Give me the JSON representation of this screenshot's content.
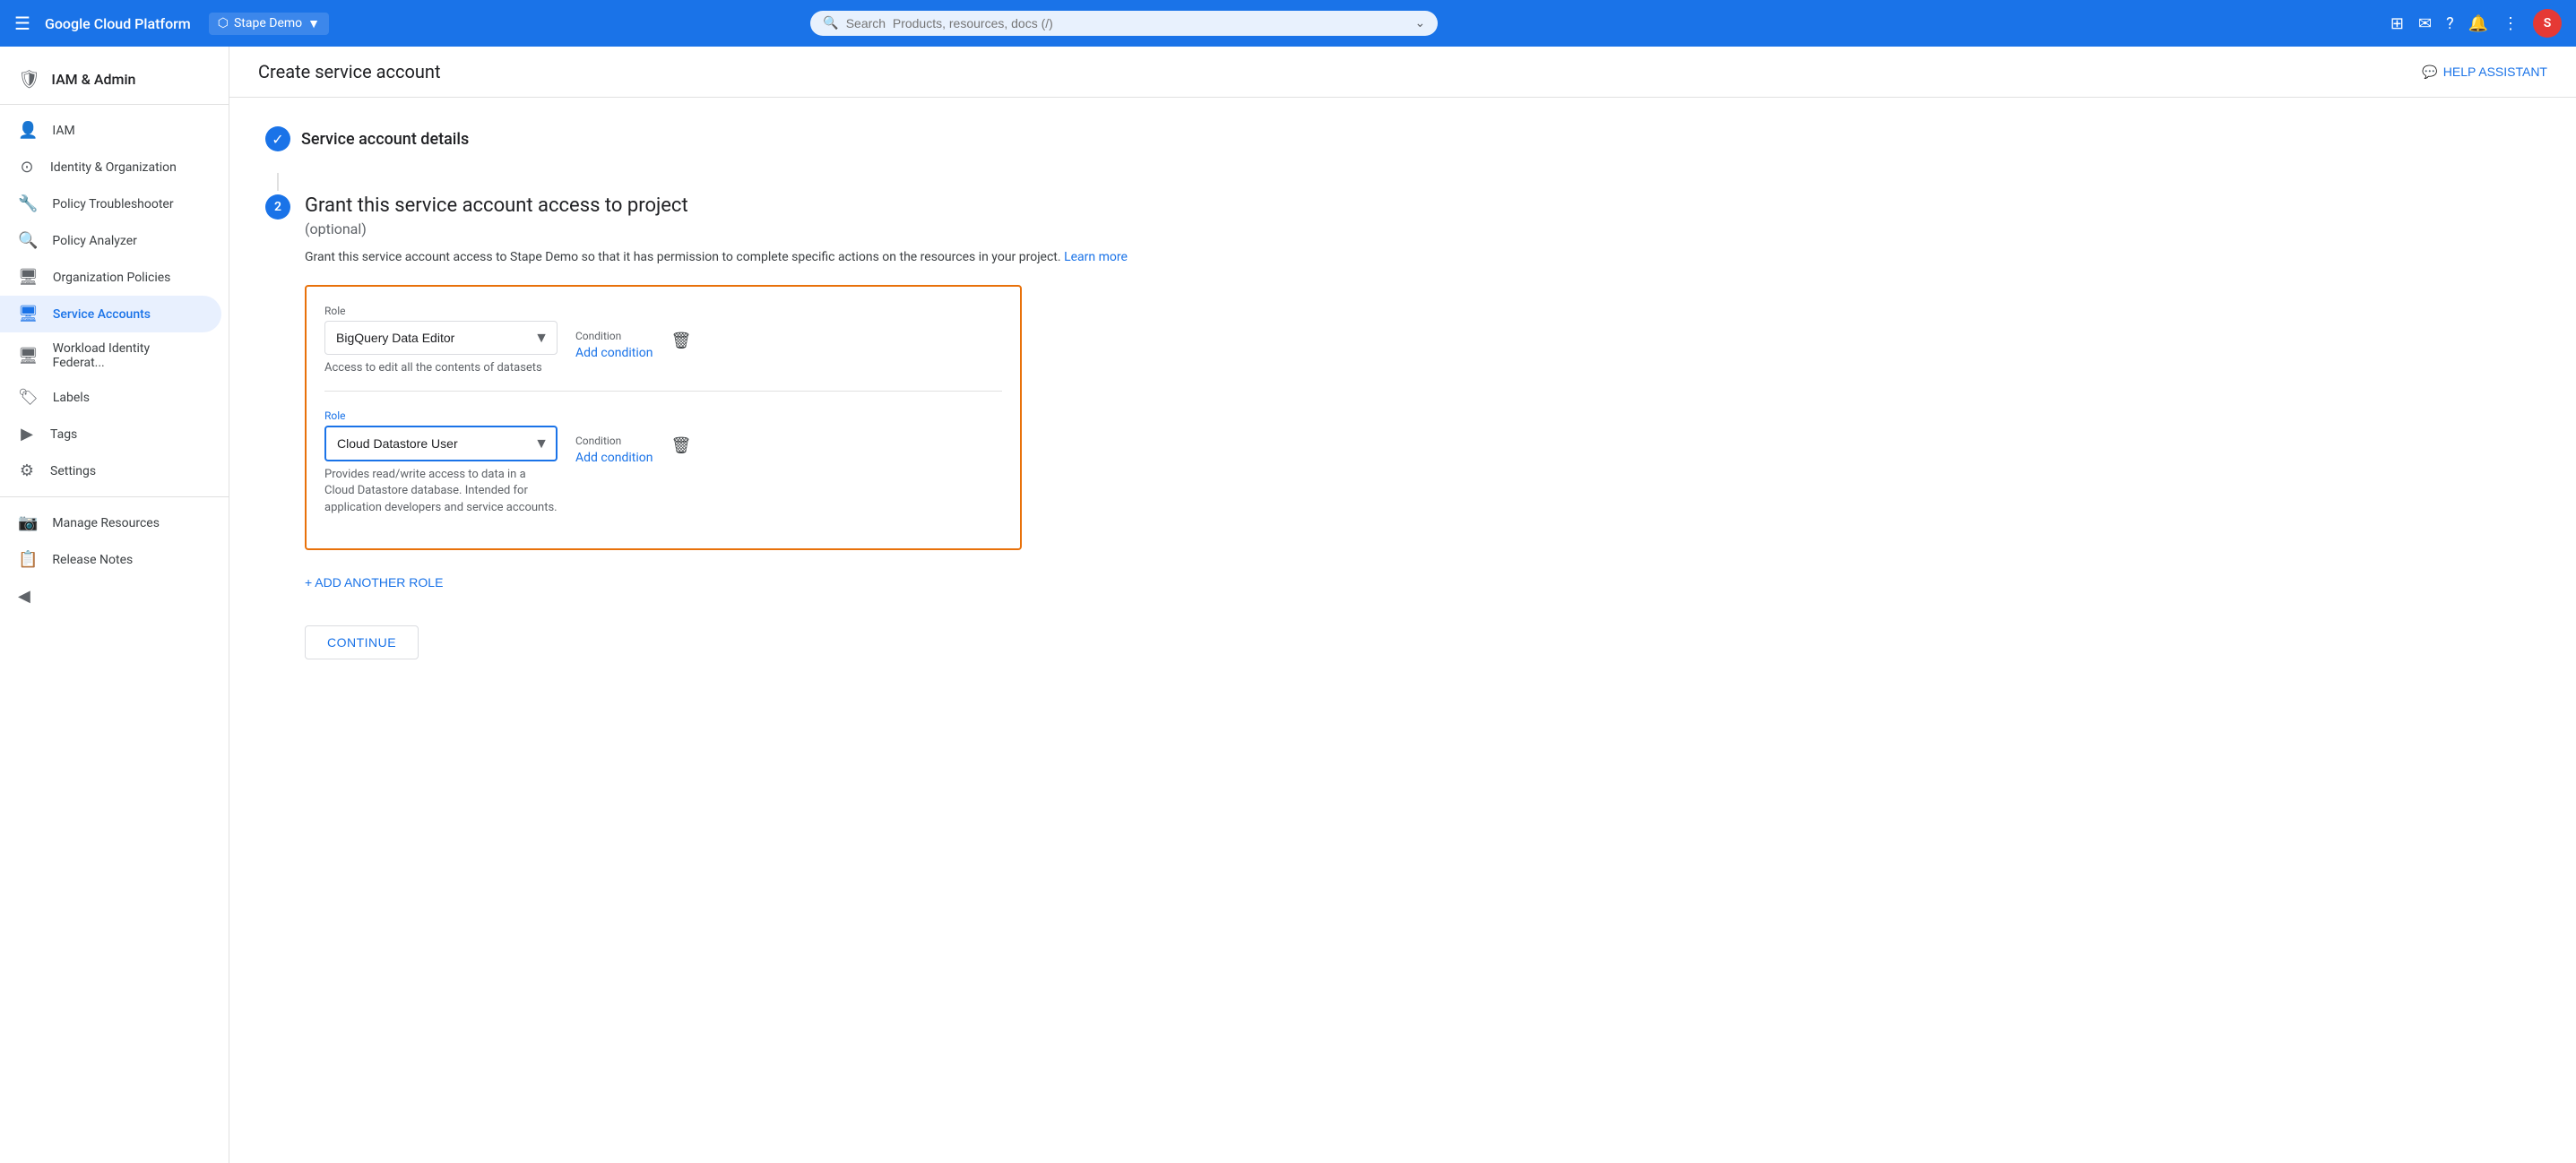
{
  "topnav": {
    "hamburger": "☰",
    "brand": "Google Cloud Platform",
    "project": {
      "icon": "⬡",
      "name": "Stape Demo",
      "chevron": "▼"
    },
    "search_placeholder": "Search  Products, resources, docs (/)",
    "search_icon": "🔍",
    "expand_icon": "⌄",
    "icons": [
      "⊞",
      "✉",
      "?",
      "🔔",
      "⋮"
    ],
    "avatar_text": "S",
    "avatar_color": "#e53935"
  },
  "sidebar": {
    "header_icon": "🛡",
    "header_title": "IAM & Admin",
    "items": [
      {
        "id": "iam",
        "label": "IAM",
        "icon": "👤",
        "active": false
      },
      {
        "id": "identity-org",
        "label": "Identity & Organization",
        "icon": "⊙",
        "active": false
      },
      {
        "id": "policy-troubleshooter",
        "label": "Policy Troubleshooter",
        "icon": "🔧",
        "active": false
      },
      {
        "id": "policy-analyzer",
        "label": "Policy Analyzer",
        "icon": "🔍",
        "active": false
      },
      {
        "id": "org-policies",
        "label": "Organization Policies",
        "icon": "🖥",
        "active": false
      },
      {
        "id": "service-accounts",
        "label": "Service Accounts",
        "icon": "🖥",
        "active": true
      },
      {
        "id": "workload-identity",
        "label": "Workload Identity Federat...",
        "icon": "🖥",
        "active": false
      },
      {
        "id": "labels",
        "label": "Labels",
        "icon": "🏷",
        "active": false
      },
      {
        "id": "tags",
        "label": "Tags",
        "icon": "▶",
        "active": false
      },
      {
        "id": "settings",
        "label": "Settings",
        "icon": "⚙",
        "active": false
      },
      {
        "id": "manage-resources",
        "label": "Manage Resources",
        "icon": "📷",
        "active": false
      },
      {
        "id": "release-notes",
        "label": "Release Notes",
        "icon": "📋",
        "active": false
      }
    ],
    "collapse_icon": "◀"
  },
  "page": {
    "title": "Create service account",
    "help_assistant": "HELP ASSISTANT"
  },
  "steps": {
    "step1": {
      "check_icon": "✓",
      "title": "Service account details"
    },
    "step2": {
      "number": "2",
      "heading": "Grant this service account access to project",
      "subheading": "(optional)",
      "description": "Grant this service account access to Stape Demo so that it has permission to complete specific actions on the resources in your project.",
      "learn_more": "Learn more"
    }
  },
  "roles": [
    {
      "id": "role1",
      "label": "Role",
      "selected": "BigQuery Data Editor",
      "description": "Access to edit all the contents of datasets",
      "condition_label": "Condition",
      "add_condition": "Add condition",
      "focused": false
    },
    {
      "id": "role2",
      "label": "Role",
      "selected": "Cloud Datastore User",
      "description": "Provides read/write access to data in a Cloud Datastore database. Intended for application developers and service accounts.",
      "condition_label": "Condition",
      "add_condition": "Add condition",
      "focused": true
    }
  ],
  "add_role_label": "+ ADD ANOTHER ROLE",
  "continue_label": "CONTINUE"
}
